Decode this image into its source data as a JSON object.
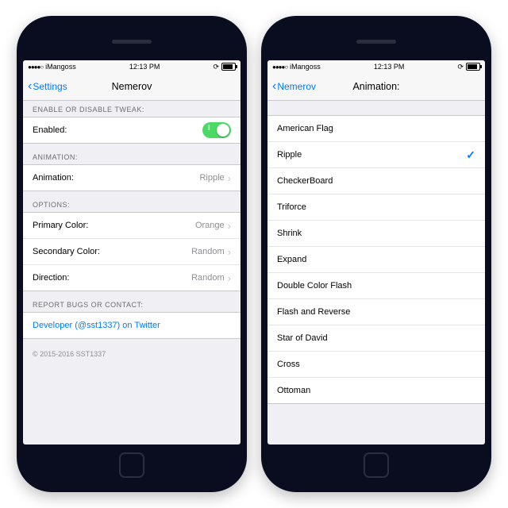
{
  "statusBar": {
    "carrier": "iMangoss",
    "time": "12:13 PM"
  },
  "left": {
    "back": "Settings",
    "title": "Nemerov",
    "groups": {
      "enable": {
        "header": "ENABLE OR DISABLE TWEAK:",
        "enabled_label": "Enabled:"
      },
      "animation": {
        "header": "ANIMATION:",
        "animation_label": "Animation:",
        "animation_value": "Ripple"
      },
      "options": {
        "header": "OPTIONS:",
        "primary_label": "Primary Color:",
        "primary_value": "Orange",
        "secondary_label": "Secondary Color:",
        "secondary_value": "Random",
        "direction_label": "Direction:",
        "direction_value": "Random"
      },
      "report": {
        "header": "REPORT BUGS OR CONTACT:",
        "link": "Developer (@sst1337) on Twitter"
      }
    },
    "footer": "© 2015-2016 SST1337"
  },
  "right": {
    "back": "Nemerov",
    "title": "Animation:",
    "selected": "Ripple",
    "items": {
      "0": "American Flag",
      "1": "Ripple",
      "2": "CheckerBoard",
      "3": "Triforce",
      "4": "Shrink",
      "5": "Expand",
      "6": "Double Color Flash",
      "7": "Flash and Reverse",
      "8": "Star of David",
      "9": "Cross",
      "10": "Ottoman"
    }
  }
}
